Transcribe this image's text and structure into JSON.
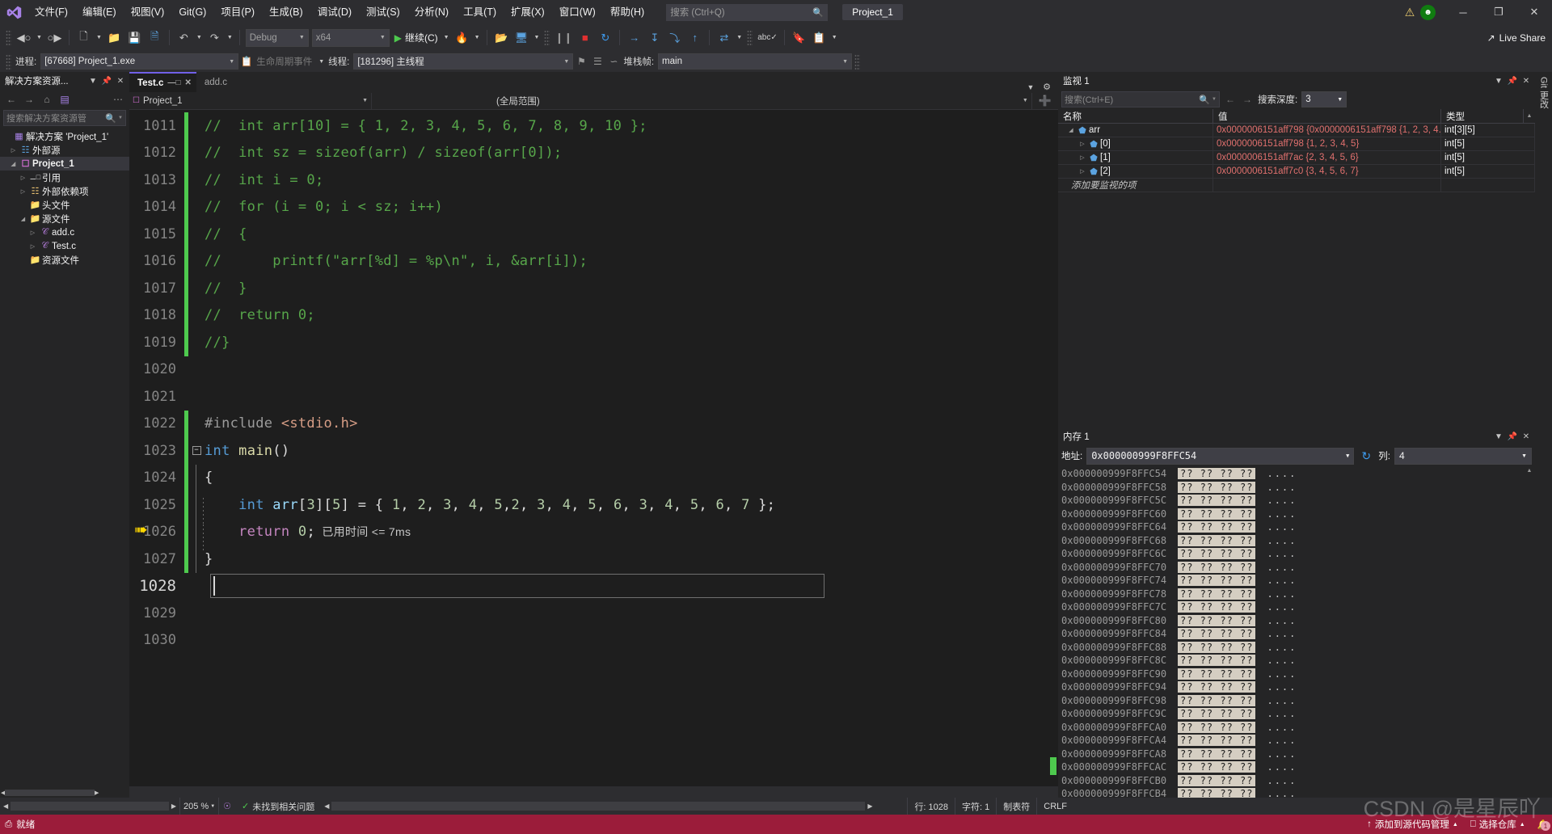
{
  "app": {
    "title_project": "Project_1",
    "logo_icon": "visual-studio-logo"
  },
  "menu": {
    "items": [
      {
        "label": "文件(F)"
      },
      {
        "label": "编辑(E)"
      },
      {
        "label": "视图(V)"
      },
      {
        "label": "Git(G)"
      },
      {
        "label": "项目(P)"
      },
      {
        "label": "生成(B)"
      },
      {
        "label": "调试(D)"
      },
      {
        "label": "测试(S)"
      },
      {
        "label": "分析(N)"
      },
      {
        "label": "工具(T)"
      },
      {
        "label": "扩展(X)"
      },
      {
        "label": "窗口(W)"
      },
      {
        "label": "帮助(H)"
      }
    ],
    "search_placeholder": "搜索 (Ctrl+Q)",
    "search_icon": "search-icon"
  },
  "window_controls": {
    "warning_icon": "warning-triangle-icon",
    "account_badge": "account-avatar",
    "minimize": "─",
    "restore": "❐",
    "close": "✕"
  },
  "toolbar": {
    "back_icon": "navigate-back-icon",
    "forward_icon": "navigate-forward-icon",
    "new_item_icon": "new-item-icon",
    "open_icon": "open-folder-icon",
    "save_icon": "save-icon",
    "save_all_icon": "save-all-icon",
    "undo_icon": "undo-icon",
    "redo_icon": "redo-icon",
    "config_value": "Debug",
    "platform_value": "x64",
    "run_label": "继续(C)",
    "run_icon": "play-icon",
    "hotreload_icon": "hot-reload-icon",
    "attach_icon": "attach-process-icon",
    "pause_icon": "pause-icon",
    "stop_icon": "stop-icon",
    "restart_icon": "restart-icon",
    "show_next_icon": "show-next-statement-icon",
    "step_into_icon": "step-into-icon",
    "step_over_icon": "step-over-icon",
    "step_out_icon": "step-out-icon",
    "diff_icon": "compare-icon",
    "spell_icon": "spell-check-icon",
    "live_share": "Live Share",
    "live_share_icon": "live-share-icon"
  },
  "debugbar": {
    "process_label": "进程:",
    "process_value": "[67668] Project_1.exe",
    "lifecycle_label": "生命周期事件",
    "lifecycle_icon": "lifecycle-events-icon",
    "thread_label": "线程:",
    "thread_value": "[181296] 主线程",
    "flag_icon": "flag-icon",
    "threads_icon": "threads-window-icon",
    "stackframe_label": "堆栈帧:",
    "stackframe_value": "main"
  },
  "solution_explorer": {
    "title": "解决方案资源...",
    "dropdown_icon": "chevron-down-icon",
    "pin_icon": "pin-icon",
    "close_icon": "close-icon",
    "toolbar": {
      "back_icon": "back-icon",
      "forward_icon": "forward-icon",
      "home_icon": "home-icon",
      "switch_view_icon": "switch-views-icon",
      "more_icon": "more-options-icon"
    },
    "search_placeholder": "搜索解决方案资源管",
    "search_icon": "search-icon",
    "tree": [
      {
        "label": "解决方案 'Project_1'",
        "icon": "solution-icon",
        "indent": 0,
        "twisty": "",
        "selected": false
      },
      {
        "label": "外部源",
        "icon": "external-sources-icon",
        "indent": 1,
        "twisty": "▷",
        "selected": false
      },
      {
        "label": "Project_1",
        "icon": "cpp-project-icon",
        "indent": 1,
        "twisty": "◢",
        "selected": true
      },
      {
        "label": "引用",
        "icon": "references-icon",
        "indent": 2,
        "twisty": "▷",
        "selected": false
      },
      {
        "label": "外部依赖项",
        "icon": "external-deps-icon",
        "indent": 2,
        "twisty": "▷",
        "selected": false
      },
      {
        "label": "头文件",
        "icon": "filter-folder-icon",
        "indent": 2,
        "twisty": "",
        "selected": false
      },
      {
        "label": "源文件",
        "icon": "filter-folder-icon",
        "indent": 2,
        "twisty": "◢",
        "selected": false
      },
      {
        "label": "add.c",
        "icon": "c-file-icon",
        "indent": 3,
        "twisty": "▷",
        "selected": false
      },
      {
        "label": "Test.c",
        "icon": "c-file-icon",
        "indent": 3,
        "twisty": "▷",
        "selected": false
      },
      {
        "label": "资源文件",
        "icon": "filter-folder-icon",
        "indent": 2,
        "twisty": "",
        "selected": false
      }
    ]
  },
  "editor": {
    "tabs": [
      {
        "label": "Test.c",
        "active": true,
        "pin_icon": "pin-icon",
        "close_icon": "close-icon"
      },
      {
        "label": "add.c",
        "active": false
      }
    ],
    "nav_project": "Project_1",
    "nav_project_icon": "cpp-project-icon",
    "nav_scope": "(全局范围)",
    "add_icon": "add-icon",
    "lines": [
      {
        "no": "1011",
        "bar": "green",
        "fold": "",
        "vline": "",
        "tokens": [
          {
            "t": "//  int arr[10] = { 1, 2, 3, 4, 5, 6, 7, 8, 9, 10 };",
            "c": "c-comment"
          }
        ]
      },
      {
        "no": "1012",
        "bar": "green",
        "fold": "",
        "vline": "",
        "tokens": [
          {
            "t": "//  int sz = sizeof(arr) / sizeof(arr[0]);",
            "c": "c-comment"
          }
        ]
      },
      {
        "no": "1013",
        "bar": "green",
        "fold": "",
        "vline": "",
        "tokens": [
          {
            "t": "//  int i = 0;",
            "c": "c-comment"
          }
        ]
      },
      {
        "no": "1014",
        "bar": "green",
        "fold": "",
        "vline": "",
        "tokens": [
          {
            "t": "//  for (i = 0; i < sz; i++)",
            "c": "c-comment"
          }
        ]
      },
      {
        "no": "1015",
        "bar": "green",
        "fold": "",
        "vline": "",
        "tokens": [
          {
            "t": "//  {",
            "c": "c-comment"
          }
        ]
      },
      {
        "no": "1016",
        "bar": "green",
        "fold": "",
        "vline": "",
        "tokens": [
          {
            "t": "//      printf(\"arr[%d] = %p\\n\", i, &arr[i]);",
            "c": "c-comment"
          }
        ]
      },
      {
        "no": "1017",
        "bar": "green",
        "fold": "",
        "vline": "",
        "tokens": [
          {
            "t": "//  }",
            "c": "c-comment"
          }
        ]
      },
      {
        "no": "1018",
        "bar": "green",
        "fold": "",
        "vline": "",
        "tokens": [
          {
            "t": "//  return 0;",
            "c": "c-comment"
          }
        ]
      },
      {
        "no": "1019",
        "bar": "green",
        "fold": "end",
        "vline": "",
        "tokens": [
          {
            "t": "//}",
            "c": "c-comment"
          }
        ]
      },
      {
        "no": "1020",
        "bar": "none",
        "fold": "",
        "vline": "",
        "tokens": []
      },
      {
        "no": "1021",
        "bar": "none",
        "fold": "",
        "vline": "",
        "tokens": []
      },
      {
        "no": "1022",
        "bar": "green",
        "fold": "",
        "vline": "",
        "tokens": [
          {
            "t": "#include ",
            "c": "c-pp"
          },
          {
            "t": "<stdio.h>",
            "c": "c-inc"
          }
        ]
      },
      {
        "no": "1023",
        "bar": "green",
        "fold": "minus",
        "vline": "",
        "tokens": [
          {
            "t": "int",
            "c": "c-kw"
          },
          {
            "t": " ",
            "c": "c-plain"
          },
          {
            "t": "main",
            "c": "c-func"
          },
          {
            "t": "()",
            "c": "c-plain"
          }
        ]
      },
      {
        "no": "1024",
        "bar": "green",
        "fold": "",
        "vline": "solid",
        "tokens": [
          {
            "t": "{",
            "c": "c-plain"
          }
        ]
      },
      {
        "no": "1025",
        "bar": "green",
        "fold": "",
        "vline": "solid-dash",
        "tokens": [
          {
            "t": "    ",
            "c": "c-plain"
          },
          {
            "t": "int",
            "c": "c-kw"
          },
          {
            "t": " ",
            "c": "c-plain"
          },
          {
            "t": "arr",
            "c": "c-id"
          },
          {
            "t": "[",
            "c": "c-plain"
          },
          {
            "t": "3",
            "c": "c-num"
          },
          {
            "t": "][",
            "c": "c-plain"
          },
          {
            "t": "5",
            "c": "c-num"
          },
          {
            "t": "] = { ",
            "c": "c-plain"
          },
          {
            "t": "1",
            "c": "c-num"
          },
          {
            "t": ", ",
            "c": "c-plain"
          },
          {
            "t": "2",
            "c": "c-num"
          },
          {
            "t": ", ",
            "c": "c-plain"
          },
          {
            "t": "3",
            "c": "c-num"
          },
          {
            "t": ", ",
            "c": "c-plain"
          },
          {
            "t": "4",
            "c": "c-num"
          },
          {
            "t": ", ",
            "c": "c-plain"
          },
          {
            "t": "5",
            "c": "c-num"
          },
          {
            "t": ",",
            "c": "c-plain"
          },
          {
            "t": "2",
            "c": "c-num"
          },
          {
            "t": ", ",
            "c": "c-plain"
          },
          {
            "t": "3",
            "c": "c-num"
          },
          {
            "t": ", ",
            "c": "c-plain"
          },
          {
            "t": "4",
            "c": "c-num"
          },
          {
            "t": ", ",
            "c": "c-plain"
          },
          {
            "t": "5",
            "c": "c-num"
          },
          {
            "t": ", ",
            "c": "c-plain"
          },
          {
            "t": "6",
            "c": "c-num"
          },
          {
            "t": ", ",
            "c": "c-plain"
          },
          {
            "t": "3",
            "c": "c-num"
          },
          {
            "t": ", ",
            "c": "c-plain"
          },
          {
            "t": "4",
            "c": "c-num"
          },
          {
            "t": ", ",
            "c": "c-plain"
          },
          {
            "t": "5",
            "c": "c-num"
          },
          {
            "t": ", ",
            "c": "c-plain"
          },
          {
            "t": "6",
            "c": "c-num"
          },
          {
            "t": ", ",
            "c": "c-plain"
          },
          {
            "t": "7",
            "c": "c-num"
          },
          {
            "t": " };",
            "c": "c-plain"
          }
        ]
      },
      {
        "no": "1026",
        "bar": "green",
        "fold": "",
        "vline": "solid-dash",
        "current": true,
        "tokens": [
          {
            "t": "    ",
            "c": "c-plain"
          },
          {
            "t": "return",
            "c": "c-kw2"
          },
          {
            "t": " ",
            "c": "c-plain"
          },
          {
            "t": "0",
            "c": "c-num"
          },
          {
            "t": ";",
            "c": "c-plain"
          },
          {
            "t": "  已用时间 <= 7ms",
            "c": "c-hint"
          }
        ]
      },
      {
        "no": "1027",
        "bar": "green",
        "fold": "",
        "vline": "solid",
        "tokens": [
          {
            "t": "}",
            "c": "c-plain"
          }
        ]
      },
      {
        "no": "1028",
        "bar": "none",
        "fold": "",
        "vline": "",
        "caret": true,
        "active_line": true,
        "tokens": []
      },
      {
        "no": "1029",
        "bar": "none",
        "fold": "",
        "vline": "",
        "tokens": []
      },
      {
        "no": "1030",
        "bar": "none",
        "fold": "",
        "vline": "",
        "tokens": []
      }
    ],
    "exec_arrow_icon": "execution-pointer-icon",
    "exec_arrow_line": "1026"
  },
  "watch": {
    "title": "监视 1",
    "dropdown_icon": "chevron-down-icon",
    "pin_icon": "pin-icon",
    "close_icon": "close-icon",
    "search_placeholder": "搜索(Ctrl+E)",
    "search_icon": "search-icon",
    "prev_icon": "arrow-left-icon",
    "next_icon": "arrow-right-icon",
    "depth_label": "搜索深度:",
    "depth_value": "3",
    "columns": [
      "名称",
      "值",
      "类型"
    ],
    "rows": [
      {
        "twisty": "◢",
        "icon": "variable-icon",
        "indent": 0,
        "name": "arr",
        "value": "0x0000006151aff798 {0x0000006151aff798 {1, 2, 3, 4...",
        "type": "int[3][5]"
      },
      {
        "twisty": "▷",
        "icon": "variable-icon",
        "indent": 1,
        "name": "[0]",
        "value": "0x0000006151aff798 {1, 2, 3, 4, 5}",
        "type": "int[5]"
      },
      {
        "twisty": "▷",
        "icon": "variable-icon",
        "indent": 1,
        "name": "[1]",
        "value": "0x0000006151aff7ac {2, 3, 4, 5, 6}",
        "type": "int[5]"
      },
      {
        "twisty": "▷",
        "icon": "variable-icon",
        "indent": 1,
        "name": "[2]",
        "value": "0x0000006151aff7c0 {3, 4, 5, 6, 7}",
        "type": "int[5]"
      }
    ],
    "add_row_placeholder": "添加要监视的项"
  },
  "memory": {
    "title": "内存 1",
    "dropdown_icon": "chevron-down-icon",
    "pin_icon": "pin-icon",
    "close_icon": "close-icon",
    "address_label": "地址:",
    "address_value": "0x000000999F8FFC54",
    "refresh_icon": "refresh-icon",
    "columns_label": "列:",
    "columns_value": "4",
    "hex_cell": "?? ?? ?? ??",
    "ascii_cell": "....",
    "rows": [
      {
        "addr": "0x000000999F8FFC54"
      },
      {
        "addr": "0x000000999F8FFC58"
      },
      {
        "addr": "0x000000999F8FFC5C"
      },
      {
        "addr": "0x000000999F8FFC60"
      },
      {
        "addr": "0x000000999F8FFC64"
      },
      {
        "addr": "0x000000999F8FFC68"
      },
      {
        "addr": "0x000000999F8FFC6C"
      },
      {
        "addr": "0x000000999F8FFC70"
      },
      {
        "addr": "0x000000999F8FFC74"
      },
      {
        "addr": "0x000000999F8FFC78"
      },
      {
        "addr": "0x000000999F8FFC7C"
      },
      {
        "addr": "0x000000999F8FFC80"
      },
      {
        "addr": "0x000000999F8FFC84"
      },
      {
        "addr": "0x000000999F8FFC88"
      },
      {
        "addr": "0x000000999F8FFC8C"
      },
      {
        "addr": "0x000000999F8FFC90"
      },
      {
        "addr": "0x000000999F8FFC94"
      },
      {
        "addr": "0x000000999F8FFC98"
      },
      {
        "addr": "0x000000999F8FFC9C"
      },
      {
        "addr": "0x000000999F8FFCA0"
      },
      {
        "addr": "0x000000999F8FFCA4"
      },
      {
        "addr": "0x000000999F8FFCA8"
      },
      {
        "addr": "0x000000999F8FFCAC"
      },
      {
        "addr": "0x000000999F8FFCB0"
      },
      {
        "addr": "0x000000999F8FFCB4"
      }
    ]
  },
  "gitbar": {
    "label": "Git 更改"
  },
  "bottombar": {
    "zoom_value": "205 %",
    "zoom_caret_icon": "chevron-down-icon",
    "accessibility_icon": "accessibility-icon",
    "issues_text": "未找到相关问题",
    "issues_icon": "check-circle-icon",
    "line_label": "行: 1028",
    "col_label": "字符: 1",
    "tabs_label": "制表符",
    "eol_label": "CRLF"
  },
  "statusbar": {
    "ready_text": "就绪",
    "ready_icon": "ready-icon",
    "source_control_text": "添加到源代码管理",
    "source_control_icon": "arrow-up-icon",
    "repo_text": "选择仓库",
    "repo_icon": "repository-icon",
    "bell_icon": "bell-icon",
    "bell_count": "1",
    "caret_icon": "chevron-up-icon",
    "bg_color": "#9b1c3a"
  },
  "watermark": {
    "text": "CSDN @是星辰吖"
  }
}
